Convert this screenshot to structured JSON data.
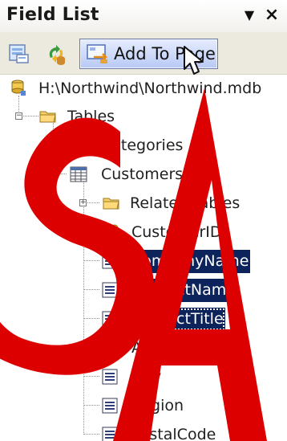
{
  "header": {
    "title": "Field List",
    "menu_icon": "dropdown-arrow-icon",
    "close_icon": "close-icon"
  },
  "toolbar": {
    "add_to_page_label": "Add To Page",
    "add_to_page_mnemonic": "A",
    "icons": [
      "show-view-icon",
      "refresh-icon",
      "add-to-page-icon"
    ]
  },
  "tree": {
    "database_path": "H:\\Northwind\\Northwind.mdb",
    "tables_label": "Tables",
    "nodes": [
      {
        "label": "Categories"
      },
      {
        "label": "Customers"
      },
      {
        "label": "Related Tables"
      },
      {
        "label": "CustomerID"
      },
      {
        "label": "CompanyName"
      },
      {
        "label": "ContactName"
      },
      {
        "label": "ContactTitle"
      },
      {
        "label": "Address"
      },
      {
        "label": "City"
      },
      {
        "label": "Region"
      },
      {
        "label": "PostalCode"
      }
    ]
  },
  "selection": {
    "selected_fields": [
      "CompanyName",
      "ContactName",
      "ContactTitle"
    ],
    "color": "#0c235b"
  },
  "watermark": {
    "text": "SA",
    "color": "#dd0000"
  },
  "colors": {
    "selection": "#0c235b",
    "toolbar_background": "#ece9df",
    "button_hover": "#c6d4fb"
  }
}
